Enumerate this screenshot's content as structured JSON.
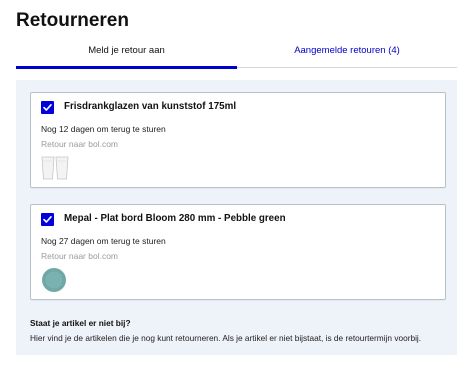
{
  "page": {
    "title": "Retourneren"
  },
  "tabs": [
    {
      "label": "Meld je retour aan",
      "active": true
    },
    {
      "label": "Aangemelde retouren (4)",
      "active": false
    }
  ],
  "items": [
    {
      "checked": true,
      "name": "Frisdrankglazen van kunststof 175ml",
      "deadline": "Nog 12 dagen om terug te sturen",
      "destination": "Retour naar bol.com",
      "image_icon": "drinking-glasses-thumbnail"
    },
    {
      "checked": true,
      "name": "Mepal - Plat bord Bloom 280 mm - Pebble green",
      "deadline": "Nog 27 dagen om terug te sturen",
      "destination": "Retour naar bol.com",
      "image_icon": "green-plate-thumbnail"
    }
  ],
  "help": {
    "question": "Staat je artikel er niet bij?",
    "answer": "Hier vind je de artikelen die je nog kunt retourneren. Als je artikel er niet bijstaat, is de retourtermijn voorbij."
  },
  "colors": {
    "accent": "#0000dd",
    "panel_bg": "#eef2f9",
    "plate": "#6fa8a6"
  }
}
